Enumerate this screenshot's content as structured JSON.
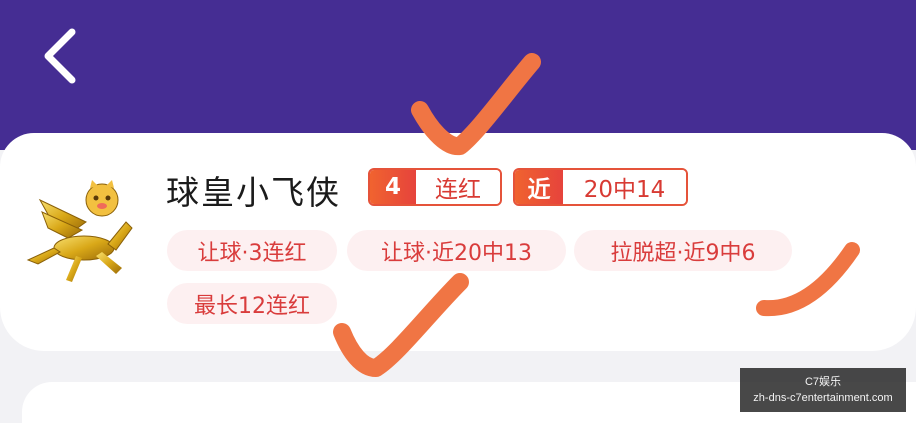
{
  "header": {
    "back_icon": "chevron-left-icon",
    "bg_color": "#452d93"
  },
  "expert": {
    "name": "球皇小飞侠",
    "avatar_icon": "golden-pegasus-icon",
    "streak_badge": {
      "number": "4",
      "label": "连红"
    },
    "recent_badge": {
      "prefix": "近",
      "label": "20中14"
    },
    "tags": [
      "让球·3连红",
      "让球·近20中13",
      "拉脱超·近9中6",
      "最长12连红"
    ]
  },
  "annotations": {
    "check_icon": "check-mark-icon",
    "color": "#f07544"
  },
  "watermark": {
    "line1": "C7娱乐",
    "line2": "zh-dns-c7entertainment.com"
  }
}
